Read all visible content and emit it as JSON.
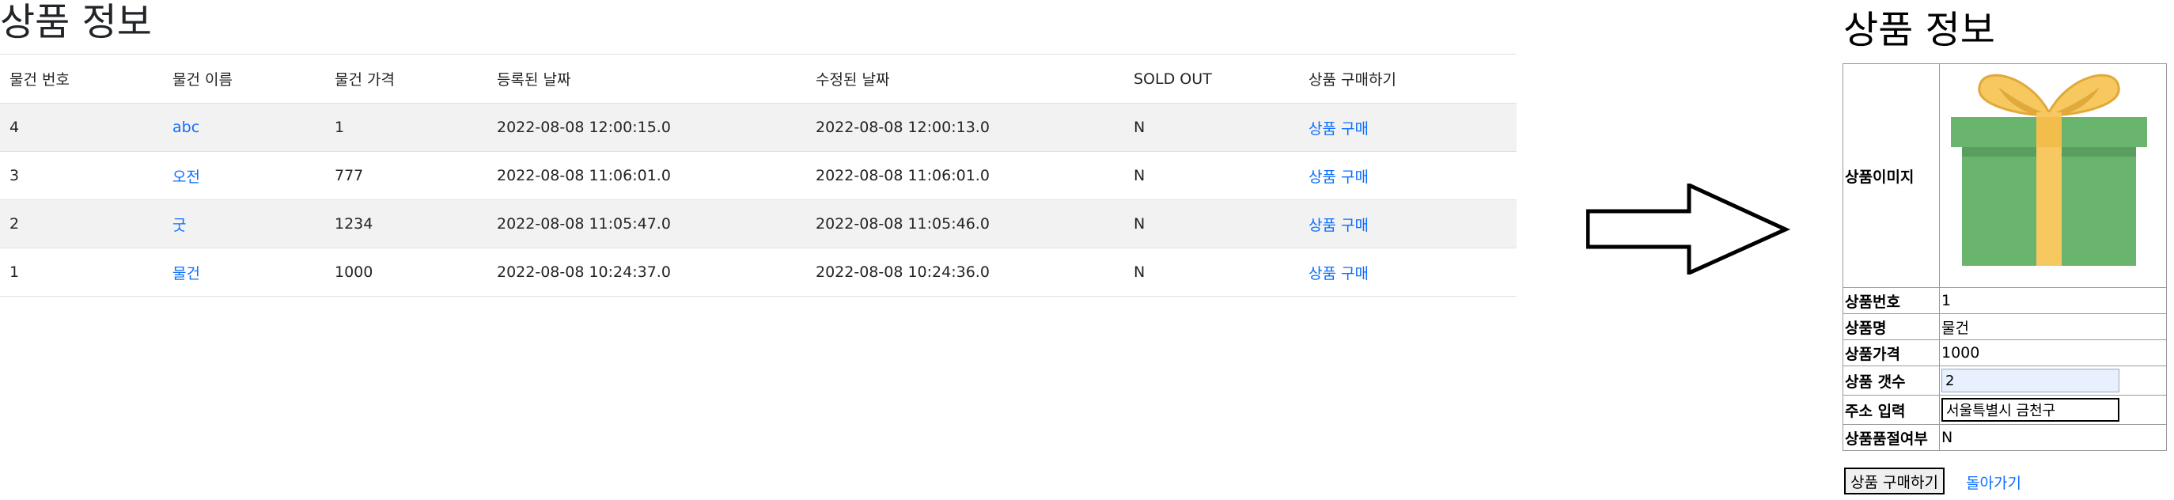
{
  "list": {
    "title": "상품 정보",
    "headers": [
      "물건 번호",
      "물건 이름",
      "물건 가격",
      "등록된 날짜",
      "수정된 날짜",
      "SOLD OUT",
      "상품 구매하기"
    ],
    "rows": [
      {
        "no": "4",
        "name": "abc",
        "price": "1",
        "created": "2022-08-08 12:00:15.0",
        "updated": "2022-08-08 12:00:13.0",
        "soldout": "N",
        "buy": "상품 구매"
      },
      {
        "no": "3",
        "name": "오전",
        "price": "777",
        "created": "2022-08-08 11:06:01.0",
        "updated": "2022-08-08 11:06:01.0",
        "soldout": "N",
        "buy": "상품 구매"
      },
      {
        "no": "2",
        "name": "굿",
        "price": "1234",
        "created": "2022-08-08 11:05:47.0",
        "updated": "2022-08-08 11:05:46.0",
        "soldout": "N",
        "buy": "상품 구매"
      },
      {
        "no": "1",
        "name": "물건",
        "price": "1000",
        "created": "2022-08-08 10:24:37.0",
        "updated": "2022-08-08 10:24:36.0",
        "soldout": "N",
        "buy": "상품 구매"
      }
    ]
  },
  "detail": {
    "title": "상품 정보",
    "image_label": "상품이미지",
    "image_icon": "gift-box-icon",
    "no_label": "상품번호",
    "no_value": "1",
    "name_label": "상품명",
    "name_value": "물건",
    "price_label": "상품가격",
    "price_value": "1000",
    "qty_label": "상품 갯수",
    "qty_value": "2",
    "address_label": "주소 입력",
    "address_value": "서울특별시 금천구",
    "soldout_label": "상품품절여부",
    "soldout_value": "N",
    "buy_button": "상품 구매하기",
    "back_link": "돌아가기"
  },
  "colors": {
    "link": "#0d6efd",
    "row_stripe": "#f2f2f2",
    "gift_body": "#6ab56e",
    "gift_ribbon": "#f6c85f"
  }
}
